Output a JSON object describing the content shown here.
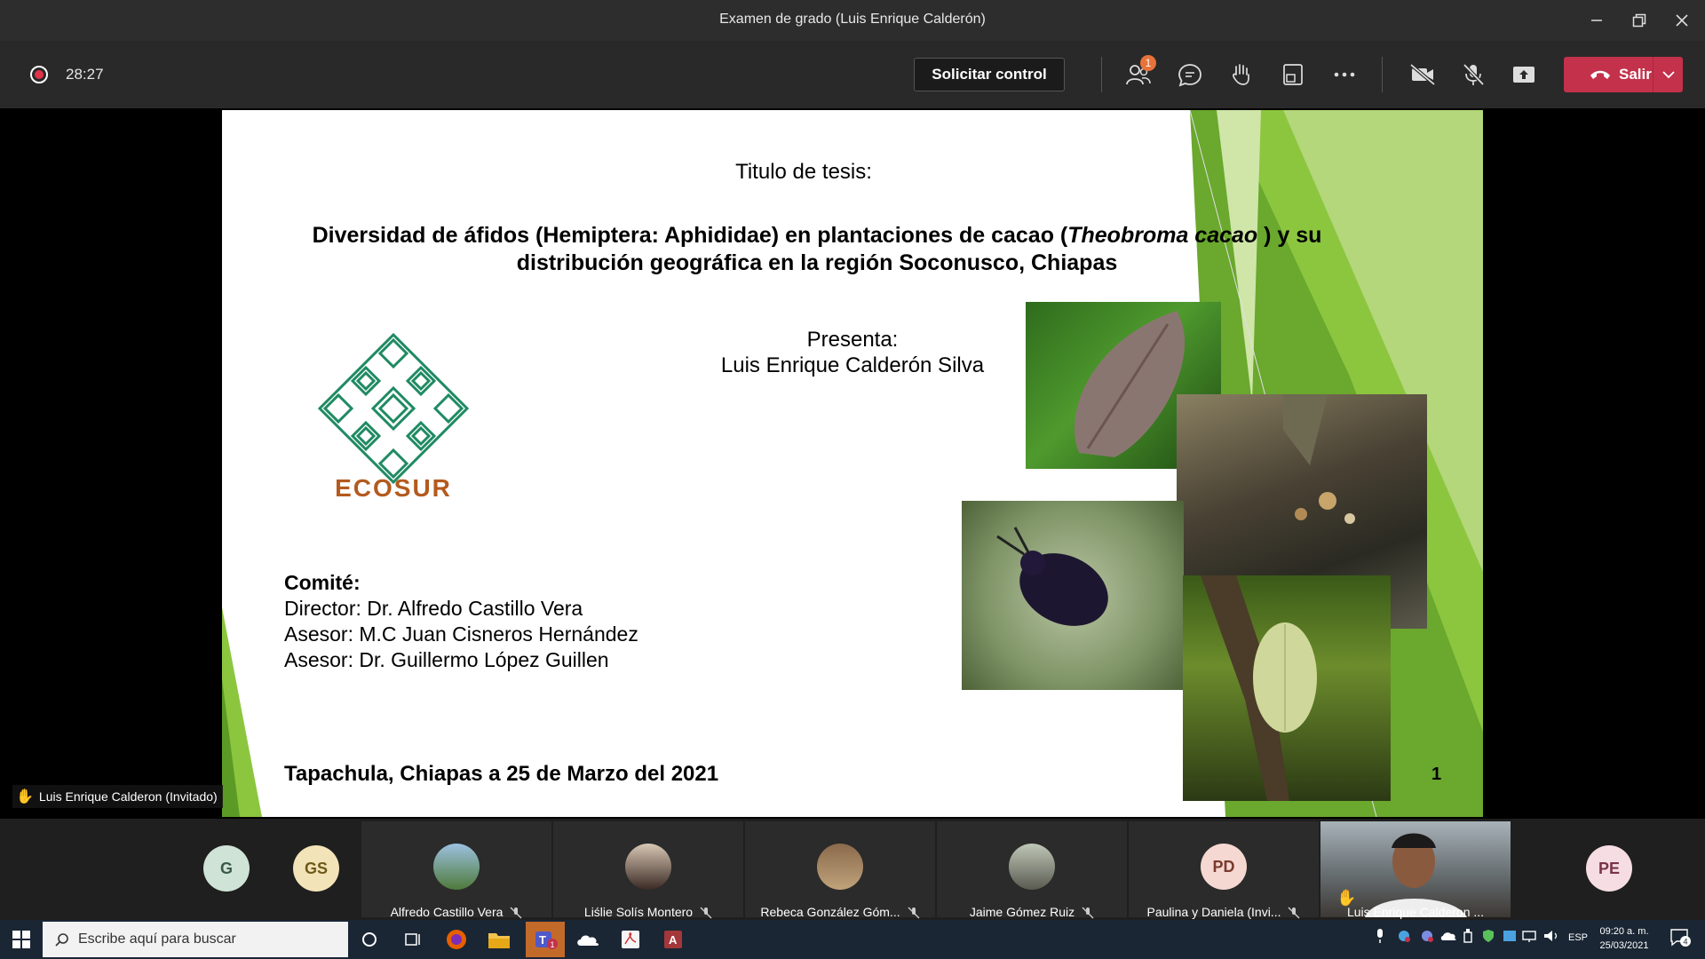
{
  "window": {
    "title": "Examen de grado (Luis Enrique Calderón)"
  },
  "meeting": {
    "timer": "28:27",
    "request_control_label": "Solicitar control",
    "participants_badge": "1",
    "leave_label": "Salir"
  },
  "presenter_label": "Luis Enrique Calderon (Invitado)",
  "slide": {
    "thesis_label": "Titulo de tesis:",
    "title_part1": "Diversidad de áfidos (Hemiptera: Aphididae) en plantaciones de cacao (",
    "title_italic": "Theobroma cacao",
    "title_part2": " ) y su distribución geográfica en la región Soconusco, Chiapas",
    "presenta_label": "Presenta:",
    "presenter_name": "Luis Enrique Calderón Silva",
    "logo_text": "ECOSUR",
    "committee_heading": "Comité:",
    "committee": [
      "Director: Dr. Alfredo Castillo Vera",
      "Asesor: M.C Juan Cisneros Hernández",
      "Asesor: Dr. Guillermo López Guillen"
    ],
    "place_date": "Tapachula, Chiapas a 25 de Marzo del 2021",
    "page_number": "1"
  },
  "participants": [
    {
      "initials": "G",
      "name": "",
      "color": "#cfe3d6",
      "text_color": "#3b5a45"
    },
    {
      "initials": "GS",
      "name": "",
      "color": "#f3e3b8",
      "text_color": "#6e5a18"
    },
    {
      "initials": "",
      "name": "Alfredo Castillo Vera"
    },
    {
      "initials": "",
      "name": "Liślie Solís Montero"
    },
    {
      "initials": "",
      "name": "Rebeca González Góm..."
    },
    {
      "initials": "",
      "name": "Jaime Gómez Ruiz"
    },
    {
      "initials": "PD",
      "name": "Paulina y Daniela (Invi...",
      "color": "#f6d8d2",
      "text_color": "#7a3a2e"
    },
    {
      "initials": "",
      "name": "Luis Enrique Calderon ..."
    },
    {
      "initials": "PE",
      "name": "",
      "color": "#f6dde3",
      "text_color": "#7a3447"
    }
  ],
  "taskbar": {
    "search_placeholder": "Escribe aquí para buscar",
    "language": "ESP",
    "time": "09:20 a. m.",
    "date": "25/03/2021",
    "notifications": "4"
  }
}
